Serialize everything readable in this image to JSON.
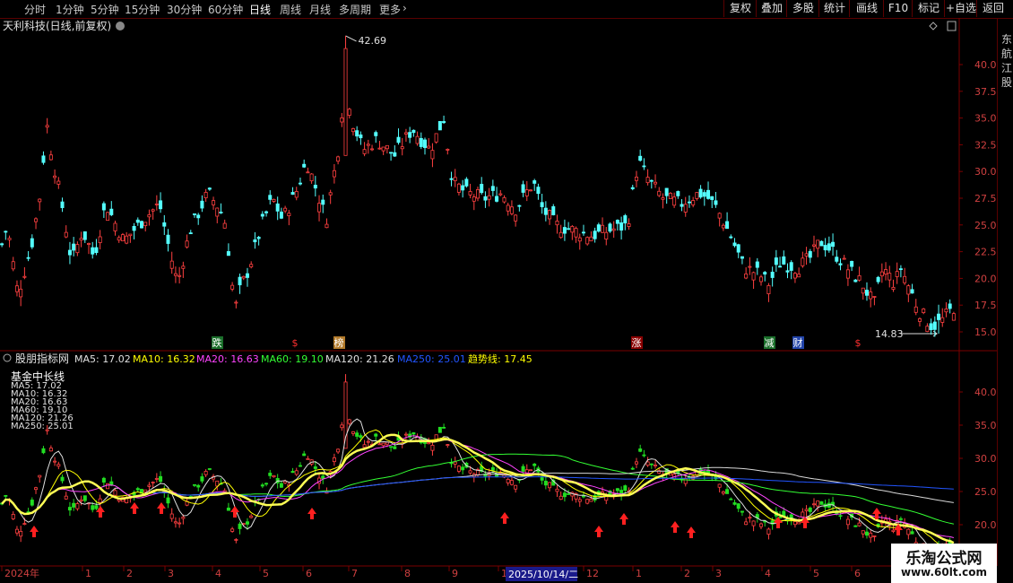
{
  "periods": [
    {
      "label": "分时"
    },
    {
      "label": "1分钟"
    },
    {
      "label": "5分钟"
    },
    {
      "label": "15分钟"
    },
    {
      "label": "30分钟"
    },
    {
      "label": "60分钟"
    },
    {
      "label": "日线",
      "active": true
    },
    {
      "label": "周线"
    },
    {
      "label": "月线"
    },
    {
      "label": "多周期"
    },
    {
      "label": "更多"
    }
  ],
  "toolbar": [
    "复权",
    "叠加",
    "多股",
    "统计",
    "画线",
    "F10",
    "标记",
    "+自选",
    "返回"
  ],
  "stock": {
    "title": "天利科技(日线,前复权)"
  },
  "price_axis": {
    "ticks": [
      "40.00",
      "37.50",
      "35.00",
      "32.50",
      "30.00",
      "27.50",
      "25.00",
      "22.50",
      "20.00",
      "17.50",
      "15.00"
    ]
  },
  "annotations": {
    "high": "42.69",
    "low": "14.83"
  },
  "event_tags": [
    {
      "label": "跌",
      "bg": "#1a6e2a",
      "fg": "#ffffff"
    },
    {
      "label": "$",
      "bg": "#000000",
      "fg": "#ff3030"
    },
    {
      "label": "榜",
      "bg": "#b27a2a",
      "fg": "#ffffff"
    },
    {
      "label": "涨",
      "bg": "#8a0000",
      "fg": "#ffffff"
    },
    {
      "label": "减",
      "bg": "#1a6e2a",
      "fg": "#ffffff"
    },
    {
      "label": "财",
      "bg": "#2244aa",
      "fg": "#ffffff"
    },
    {
      "label": "$",
      "bg": "#000000",
      "fg": "#ff3030"
    }
  ],
  "indicator": {
    "name": "股朋指标网",
    "legend": [
      {
        "text": "MA5: 17.02",
        "color": "#e0e0e0"
      },
      {
        "text": "MA10: 16.32",
        "color": "#ffff00"
      },
      {
        "text": "MA20: 16.63",
        "color": "#ff44ff"
      },
      {
        "text": "MA60: 19.10",
        "color": "#33ff33"
      },
      {
        "text": "MA120: 21.26",
        "color": "#e0e0e0"
      },
      {
        "text": "MA250: 25.01",
        "color": "#2255ff"
      },
      {
        "text": "趋势线: 17.45",
        "color": "#ffff00"
      }
    ],
    "box_title": "基金中长线",
    "box_lines": [
      "MA5:   17.02",
      "MA10:  16.32",
      "MA20:  16.63",
      "MA60:  19.10",
      "MA120: 21.26",
      "MA250: 25.01"
    ],
    "axis_ticks": [
      "40.00",
      "35.00",
      "30.00",
      "25.00",
      "20.00"
    ]
  },
  "time_axis": {
    "labels": [
      "2024年",
      "1",
      "2",
      "3",
      "4",
      "5",
      "6",
      "7",
      "8",
      "9",
      "11",
      "12",
      "1",
      "2",
      "3",
      "4",
      "5",
      "6"
    ],
    "cursor": "2025/10/14/二"
  },
  "watermark": {
    "line1": "乐淘公式网",
    "line2": "www.60lt.com"
  },
  "sidebar_text": "东航江股"
}
